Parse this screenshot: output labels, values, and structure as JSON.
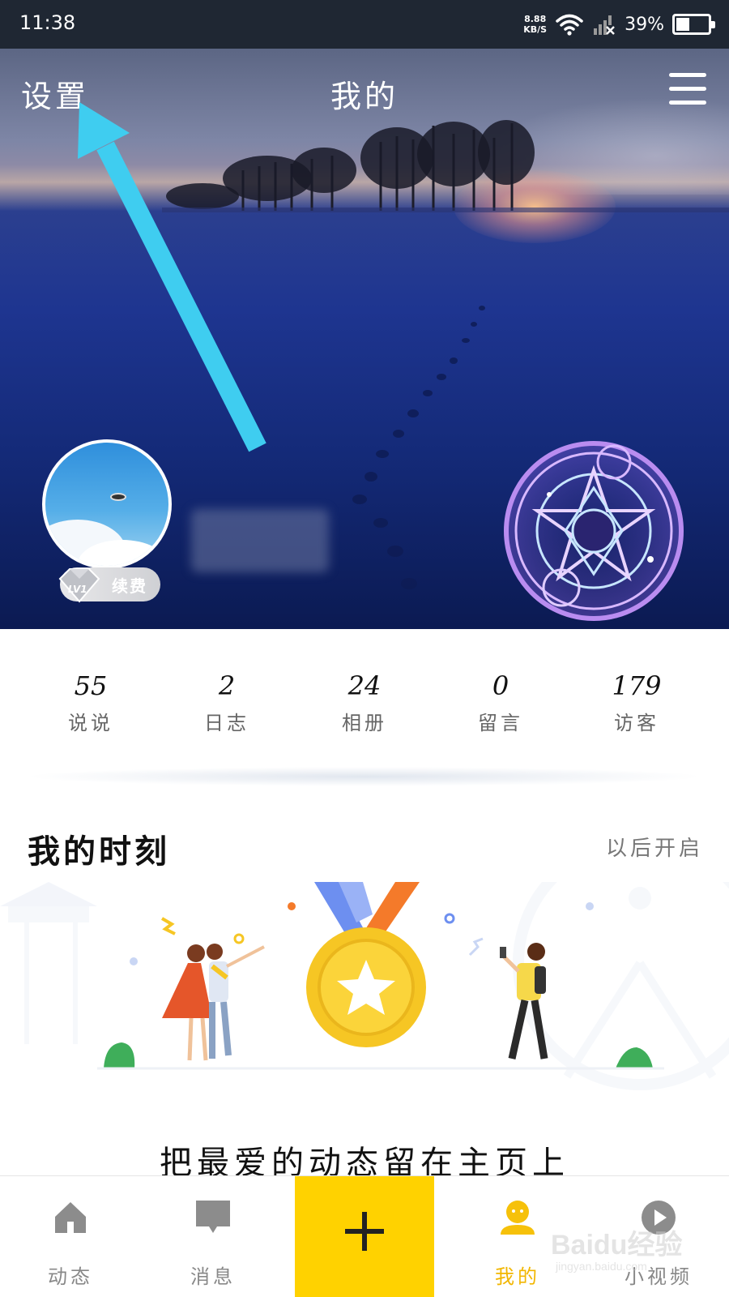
{
  "status_bar": {
    "time": "11:38",
    "net_speed_value": "8.88",
    "net_speed_unit": "KB/S",
    "battery_percent": "39%",
    "battery_level": 0.39
  },
  "header": {
    "settings_label": "设置",
    "title": "我的",
    "menu_icon": "hamburger-menu-icon"
  },
  "profile": {
    "vip_level": "LV1",
    "vip_action": "续费"
  },
  "stats": [
    {
      "value": "55",
      "label": "说说"
    },
    {
      "value": "2",
      "label": "日志"
    },
    {
      "value": "24",
      "label": "相册"
    },
    {
      "value": "0",
      "label": "留言"
    },
    {
      "value": "179",
      "label": "访客"
    }
  ],
  "moments": {
    "title": "我的时刻",
    "action": "以后开启",
    "tagline": "把最爱的动态留在主页上"
  },
  "bottom_nav": {
    "items": [
      {
        "label": "动态",
        "icon": "home-icon"
      },
      {
        "label": "消息",
        "icon": "message-icon"
      },
      {
        "label": "我的",
        "icon": "profile-icon"
      },
      {
        "label": "小视频",
        "icon": "play-icon"
      }
    ],
    "plus_icon": "plus-icon",
    "active_color": "#f2b600",
    "plus_bg": "#ffd200"
  },
  "annotation": {
    "arrow_color": "#3fcdf0"
  },
  "watermark": {
    "main": "Baidu经验",
    "sub": "jingyan.baidu.com"
  }
}
